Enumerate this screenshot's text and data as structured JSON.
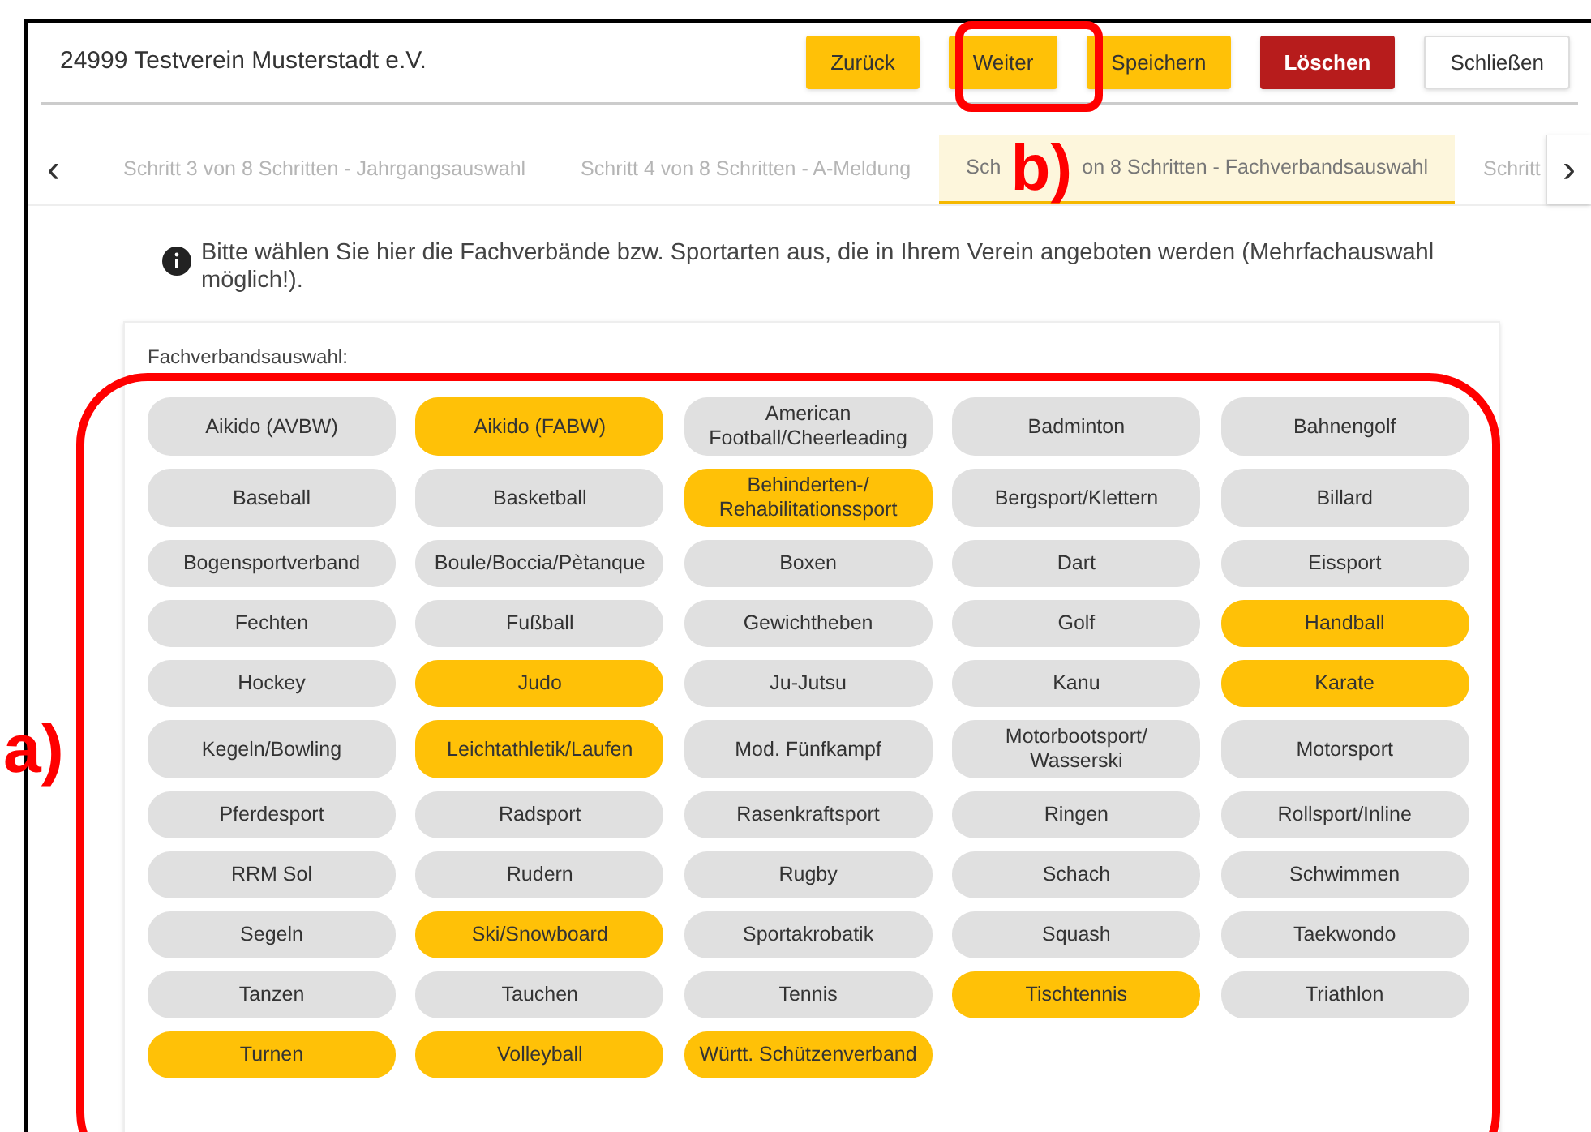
{
  "header": {
    "title": "24999 Testverein Musterstadt e.V.",
    "buttons": [
      {
        "label": "Zurück",
        "kind": "primary"
      },
      {
        "label": "Weiter",
        "kind": "primary"
      },
      {
        "label": "Speichern",
        "kind": "primary"
      },
      {
        "label": "Löschen",
        "kind": "danger"
      },
      {
        "label": "Schließen",
        "kind": "plain"
      }
    ]
  },
  "steps": {
    "prev": "‹",
    "next": "›",
    "tabs": [
      {
        "label": "Schritt 3 von 8 Schritten - Jahrgangsauswahl",
        "selected": false
      },
      {
        "label": "Schritt 4 von 8 Schritten - A-Meldung",
        "selected": false
      },
      {
        "label": "Sch",
        "label_end": "on 8 Schritten - Fachverbandsauswahl",
        "selected": true
      },
      {
        "label": "Schritt",
        "selected": false
      }
    ]
  },
  "info": "Bitte wählen Sie hier die Fachverbände bzw. Sportarten aus, die in Ihrem Verein angeboten werden (Mehrfachauswahl möglich!).",
  "selection": {
    "label": "Fachverbandsauswahl:",
    "options": [
      {
        "label": "Aikido (AVBW)",
        "selected": false
      },
      {
        "label": "Aikido (FABW)",
        "selected": true
      },
      {
        "label": "American Football/Cheerleading",
        "selected": false
      },
      {
        "label": "Badminton",
        "selected": false
      },
      {
        "label": "Bahnengolf",
        "selected": false
      },
      {
        "label": "Baseball",
        "selected": false
      },
      {
        "label": "Basketball",
        "selected": false
      },
      {
        "label": "Behinderten-/ Rehabilitationssport",
        "selected": true
      },
      {
        "label": "Bergsport/Klettern",
        "selected": false
      },
      {
        "label": "Billard",
        "selected": false
      },
      {
        "label": "Bogensportverband",
        "selected": false
      },
      {
        "label": "Boule/Boccia/Pètanque",
        "selected": false
      },
      {
        "label": "Boxen",
        "selected": false
      },
      {
        "label": "Dart",
        "selected": false
      },
      {
        "label": "Eissport",
        "selected": false
      },
      {
        "label": "Fechten",
        "selected": false
      },
      {
        "label": "Fußball",
        "selected": false
      },
      {
        "label": "Gewichtheben",
        "selected": false
      },
      {
        "label": "Golf",
        "selected": false
      },
      {
        "label": "Handball",
        "selected": true
      },
      {
        "label": "Hockey",
        "selected": false
      },
      {
        "label": "Judo",
        "selected": true
      },
      {
        "label": "Ju-Jutsu",
        "selected": false
      },
      {
        "label": "Kanu",
        "selected": false
      },
      {
        "label": "Karate",
        "selected": true
      },
      {
        "label": "Kegeln/Bowling",
        "selected": false
      },
      {
        "label": "Leichtathletik/Laufen",
        "selected": true
      },
      {
        "label": "Mod. Fünfkampf",
        "selected": false
      },
      {
        "label": "Motorbootsport/ Wasserski",
        "selected": false
      },
      {
        "label": "Motorsport",
        "selected": false
      },
      {
        "label": "Pferdesport",
        "selected": false
      },
      {
        "label": "Radsport",
        "selected": false
      },
      {
        "label": "Rasenkraftsport",
        "selected": false
      },
      {
        "label": "Ringen",
        "selected": false
      },
      {
        "label": "Rollsport/Inline",
        "selected": false
      },
      {
        "label": "RRM Sol",
        "selected": false
      },
      {
        "label": "Rudern",
        "selected": false
      },
      {
        "label": "Rugby",
        "selected": false
      },
      {
        "label": "Schach",
        "selected": false
      },
      {
        "label": "Schwimmen",
        "selected": false
      },
      {
        "label": "Segeln",
        "selected": false
      },
      {
        "label": "Ski/Snowboard",
        "selected": true
      },
      {
        "label": "Sportakrobatik",
        "selected": false
      },
      {
        "label": "Squash",
        "selected": false
      },
      {
        "label": "Taekwondo",
        "selected": false
      },
      {
        "label": "Tanzen",
        "selected": false
      },
      {
        "label": "Tauchen",
        "selected": false
      },
      {
        "label": "Tennis",
        "selected": false
      },
      {
        "label": "Tischtennis",
        "selected": true
      },
      {
        "label": "Triathlon",
        "selected": false
      },
      {
        "label": "Turnen",
        "selected": true
      },
      {
        "label": "Volleyball",
        "selected": true
      },
      {
        "label": "Württ. Schützenverband",
        "selected": true
      }
    ]
  },
  "annotations": [
    {
      "label": "a)"
    },
    {
      "label": "b)"
    }
  ]
}
